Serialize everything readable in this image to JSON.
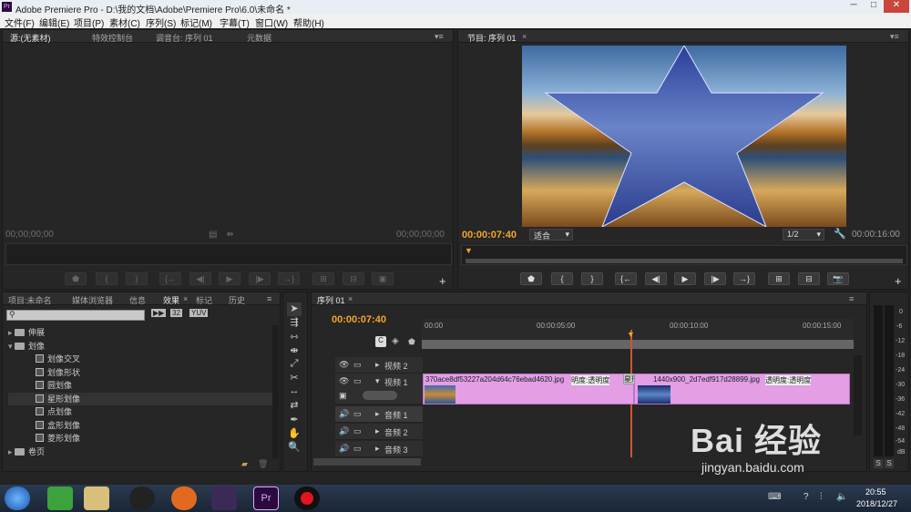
{
  "window": {
    "title": "Adobe Premiere Pro - D:\\我的文档\\Adobe\\Premiere Pro\\6.0\\未命名 *",
    "app_badge": "Pr"
  },
  "menu": [
    "文件(F)",
    "编辑(E)",
    "项目(P)",
    "素材(C)",
    "序列(S)",
    "标记(M)",
    "字幕(T)",
    "窗口(W)",
    "帮助(H)"
  ],
  "source": {
    "tabs": [
      "源:(无素材)",
      "特效控制台",
      "调音台: 序列 01",
      "元数据"
    ],
    "tc_left": "00;00;00;00",
    "tc_right": "00;00;00;00"
  },
  "program": {
    "tab": "节目: 序列 01",
    "tc": "00:00:07:40",
    "fit": "适合",
    "res": "1/2",
    "duration": "00:00:16:00"
  },
  "project": {
    "tabs": [
      "项目:未命名",
      "媒体浏览器",
      "信息",
      "效果",
      "标记",
      "历史"
    ],
    "badges": [
      "32",
      "YUV"
    ],
    "tree": [
      {
        "label": "伸展",
        "type": "folder"
      },
      {
        "label": "划像",
        "type": "folder"
      },
      {
        "label": "划像交叉",
        "type": "item"
      },
      {
        "label": "划像形状",
        "type": "item"
      },
      {
        "label": "圆划像",
        "type": "item"
      },
      {
        "label": "星形划像",
        "type": "item"
      },
      {
        "label": "点划像",
        "type": "item"
      },
      {
        "label": "盒形划像",
        "type": "item"
      },
      {
        "label": "菱形划像",
        "type": "item"
      },
      {
        "label": "卷页",
        "type": "folder"
      }
    ]
  },
  "timeline": {
    "tab": "序列 01",
    "tc": "00:00:07:40",
    "ruler": [
      "00:00",
      "00:00:05:00",
      "00:00:10:00",
      "00:00:15:00"
    ],
    "tracks": [
      "视频 2",
      "视频 1",
      "音频 1",
      "音频 2",
      "音频 3"
    ],
    "clip1_name": "370ace8df53227a204d64c76ebad4620.jpg",
    "clip1_fx": "明度:透明度",
    "transition": "星形划",
    "clip2_name": "1440x900_2d7edf917d28899.jpg",
    "clip2_fx": "透明度:透明度"
  },
  "meter": {
    "labels": [
      "0",
      "-6",
      "-12",
      "-18",
      "-24",
      "-30",
      "-36",
      "-42",
      "-48",
      "-54",
      "dB"
    ],
    "solo": [
      "S",
      "S"
    ]
  },
  "taskbar": {
    "time": "20:55",
    "date": "2018/12/27"
  },
  "watermark": {
    "brand": "Bai 经验",
    "url": "jingyan.baidu.com"
  }
}
